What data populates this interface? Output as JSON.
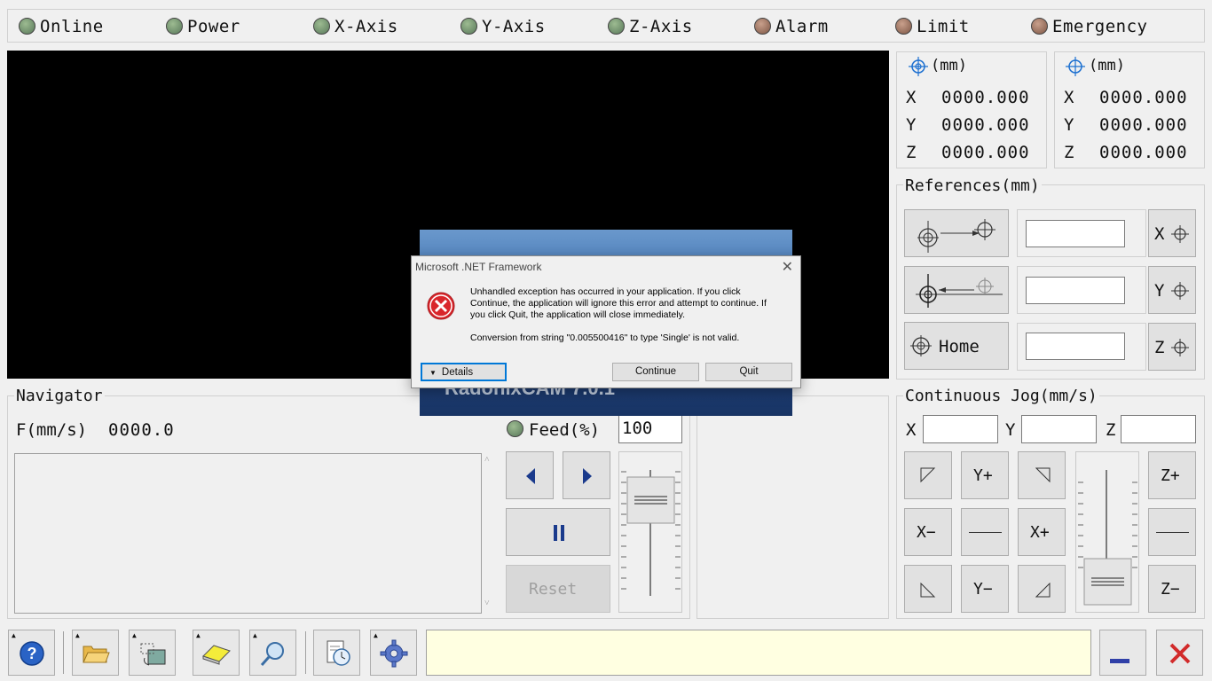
{
  "status": {
    "indicators": [
      {
        "label": "Online",
        "state": "green"
      },
      {
        "label": "Power",
        "state": "green"
      },
      {
        "label": "X-Axis",
        "state": "green"
      },
      {
        "label": "Y-Axis",
        "state": "green"
      },
      {
        "label": "Z-Axis",
        "state": "green"
      },
      {
        "label": "Alarm",
        "state": "brown"
      },
      {
        "label": "Limit",
        "state": "brown"
      },
      {
        "label": "Emergency",
        "state": "brown"
      }
    ]
  },
  "coords": {
    "machine": {
      "unit": "(mm)",
      "x_label": "X",
      "y_label": "Y",
      "z_label": "Z",
      "x": "0000.000",
      "y": "0000.000",
      "z": "0000.000"
    },
    "work": {
      "unit": "(mm)",
      "x_label": "X",
      "y_label": "Y",
      "z_label": "Z",
      "x": "0000.000",
      "y": "0000.000",
      "z": "0000.000"
    }
  },
  "references": {
    "title": "References(mm)",
    "home_label": "Home",
    "x_label": "X",
    "y_label": "Y",
    "z_label": "Z",
    "x_value": "",
    "y_value": "",
    "z_value": ""
  },
  "navigator": {
    "title": "Navigator",
    "feed_label": "F(mm/s)",
    "feed_value": "0000.0",
    "feed_pct_label": "Feed(%)",
    "feed_pct_value": "100",
    "reset_label": "Reset"
  },
  "jog": {
    "title": "Continuous Jog(mm/s)",
    "x_label": "X",
    "y_label": "Y",
    "z_label": "Z",
    "x_value": "",
    "y_value": "",
    "z_value": "",
    "yplus": "Y+",
    "yminus": "Y−",
    "xplus": "X+",
    "xminus": "X−",
    "zplus": "Z+",
    "zminus": "Z−"
  },
  "banner": {
    "text": "RadonixCAM 7.0.1"
  },
  "dialog": {
    "title": "Microsoft .NET Framework",
    "message": "Unhandled exception has occurred in your application. If you click Continue, the application will ignore this error and attempt to continue. If you click Quit, the application will close immediately.",
    "error": "Conversion from string \"0.005500416\" to type 'Single' is not valid.",
    "details_label": "Details",
    "continue_label": "Continue",
    "quit_label": "Quit"
  },
  "toolbar": {
    "message": "",
    "icons": [
      "help-icon",
      "open-folder-icon",
      "rotate-image-icon",
      "eraser-icon",
      "zoom-icon",
      "timer-document-icon",
      "settings-gear-icon",
      "minimize-icon",
      "close-icon"
    ]
  },
  "colors": {
    "led_green": "#6f8f69",
    "led_brown": "#9c6f5b",
    "message_bg": "#ffffe1",
    "close_red": "#d22b2b",
    "dialog_error_red": "#d9262b"
  }
}
